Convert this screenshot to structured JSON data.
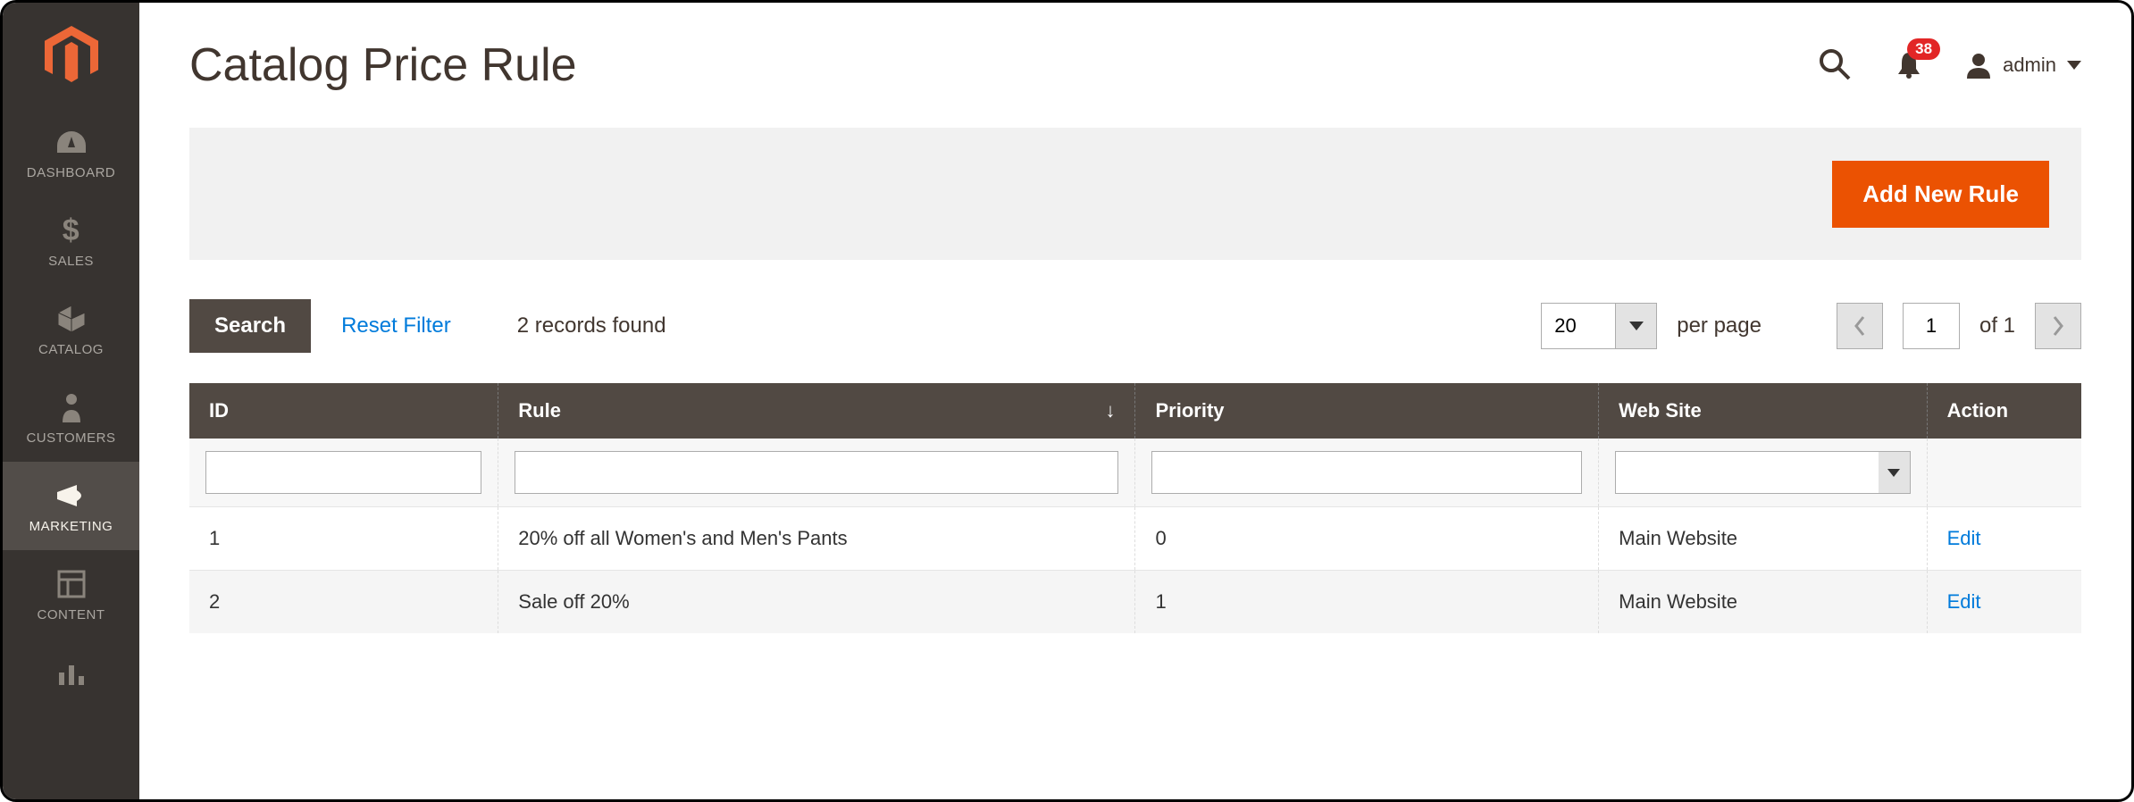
{
  "header": {
    "page_title": "Catalog Price Rule",
    "notif_count": "38",
    "user_label": "admin"
  },
  "sidebar": {
    "items": [
      {
        "label": "DASHBOARD"
      },
      {
        "label": "SALES"
      },
      {
        "label": "CATALOG"
      },
      {
        "label": "CUSTOMERS"
      },
      {
        "label": "MARKETING"
      },
      {
        "label": "CONTENT"
      }
    ]
  },
  "actions": {
    "add_rule_label": "Add New Rule",
    "search_button": "Search",
    "reset_filter": "Reset Filter",
    "records_found": "2 records found",
    "per_page_value": "20",
    "per_page_label": "per page",
    "page_current": "1",
    "page_of_label": "of 1"
  },
  "table": {
    "columns": {
      "id": "ID",
      "rule": "Rule",
      "priority": "Priority",
      "website": "Web Site",
      "action": "Action"
    },
    "rows": [
      {
        "id": "1",
        "rule": "20% off all Women's and Men's Pants",
        "priority": "0",
        "website": "Main Website",
        "action": "Edit"
      },
      {
        "id": "2",
        "rule": "Sale off 20%",
        "priority": "1",
        "website": "Main Website",
        "action": "Edit"
      }
    ]
  }
}
